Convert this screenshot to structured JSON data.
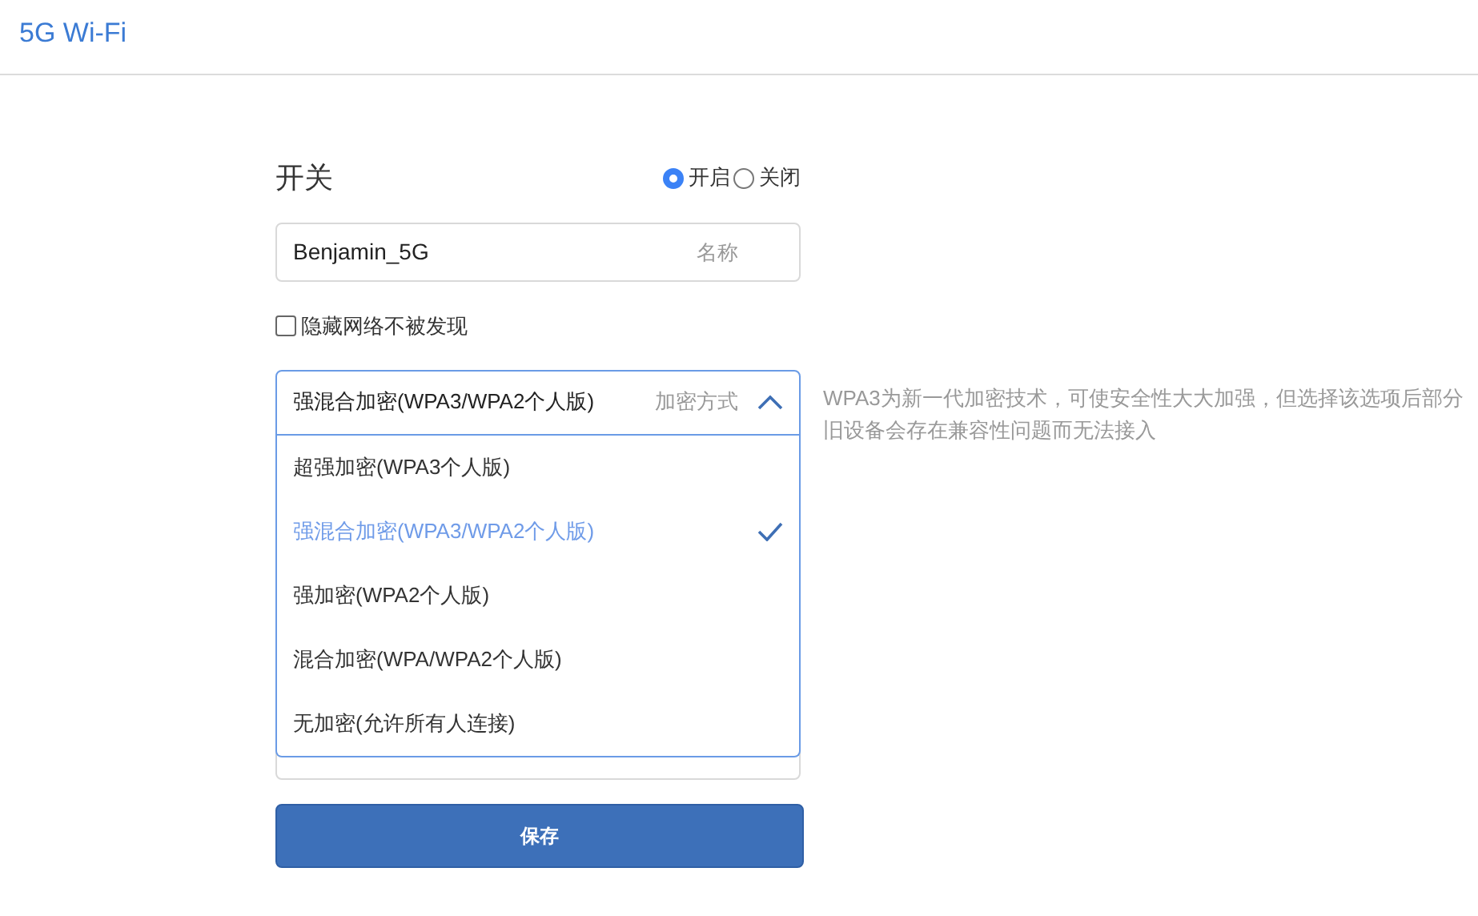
{
  "page": {
    "title": "5G Wi-Fi"
  },
  "switch": {
    "label": "开关",
    "options": [
      {
        "label": "开启",
        "selected": true
      },
      {
        "label": "关闭",
        "selected": false
      }
    ]
  },
  "name_field": {
    "value": "Benjamin_5G",
    "label": "名称"
  },
  "hide_network": {
    "label": "隐藏网络不被发现",
    "checked": false
  },
  "encryption": {
    "value": "强混合加密(WPA3/WPA2个人版)",
    "label": "加密方式",
    "expanded": true,
    "hint": "WPA3为新一代加密技术，可使安全性大大加强，但选择该选项后部分旧设备会存在兼容性问题而无法接入",
    "options": [
      {
        "label": "超强加密(WPA3个人版)",
        "selected": false
      },
      {
        "label": "强混合加密(WPA3/WPA2个人版)",
        "selected": true
      },
      {
        "label": "强加密(WPA2个人版)",
        "selected": false
      },
      {
        "label": "混合加密(WPA/WPA2个人版)",
        "selected": false
      },
      {
        "label": "无加密(允许所有人连接)",
        "selected": false
      }
    ]
  },
  "save_button": {
    "label": "保存"
  }
}
